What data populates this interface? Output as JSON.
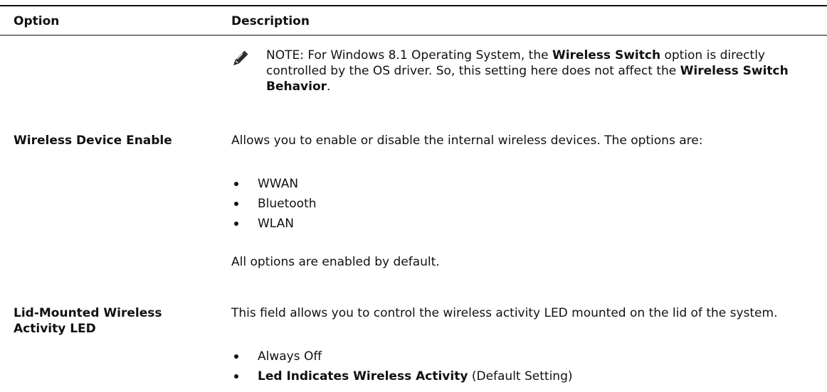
{
  "table": {
    "header": {
      "option": "Option",
      "description": "Description"
    }
  },
  "note": {
    "icon": "pencil-note-icon",
    "label": "NOTE:",
    "text_1": " For Windows 8.1 Operating System, the ",
    "bold_1": "Wireless Switch",
    "text_2": " option is directly controlled by the OS driver. So, this setting here does not affect the ",
    "bold_2": "Wireless Switch Behavior",
    "text_3": "."
  },
  "rows": [
    {
      "option": "Wireless Device Enable",
      "description": "Allows you to enable or disable the internal wireless devices. The options are:",
      "bullets": [
        "WWAN",
        "Bluetooth",
        "WLAN"
      ],
      "footer": "All options are enabled by default."
    },
    {
      "option": "Lid-Mounted Wireless Activity LED",
      "description": "This field allows you to control the wireless activity LED mounted on the lid of the system.",
      "bullets": [
        {
          "text": "Always Off"
        },
        {
          "bold": "Led Indicates Wireless Activity",
          "text": " (Default Setting)"
        }
      ]
    }
  ]
}
